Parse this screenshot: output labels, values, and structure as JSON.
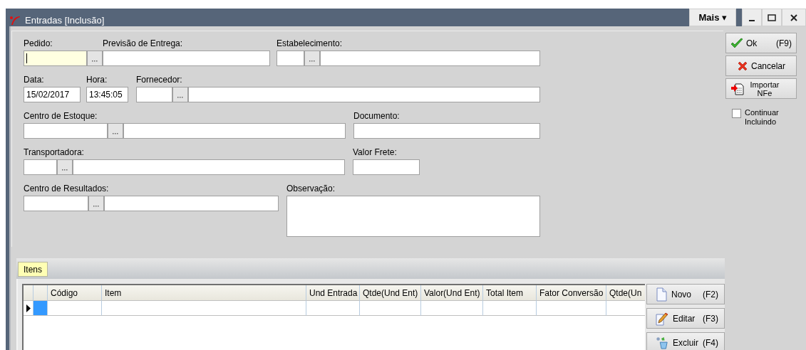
{
  "window": {
    "title": "Entradas [Inclusão]",
    "more_button": "Mais ▾"
  },
  "form": {
    "rows": [
      {
        "fields": [
          {
            "kind": "code",
            "label": "Pedido:",
            "focused": true
          },
          {
            "kind": "text",
            "label": "Previsão de Entrega:"
          },
          {
            "kind": "lookup",
            "label": "Estabelecimento:"
          }
        ]
      },
      {
        "fields": [
          {
            "kind": "text",
            "label": "Data:",
            "value": "15/02/2017"
          },
          {
            "kind": "text",
            "label": "Hora:",
            "value": "13:45:05"
          },
          {
            "kind": "lookup",
            "label": "Fornecedor:"
          }
        ]
      },
      {
        "fields": [
          {
            "kind": "lookup",
            "label": "Centro de Estoque:"
          },
          {
            "kind": "text",
            "label": "Documento:"
          }
        ]
      },
      {
        "fields": [
          {
            "kind": "lookup",
            "label": "Transportadora:"
          },
          {
            "kind": "text",
            "label": "Valor Frete:"
          }
        ]
      },
      {
        "fields": [
          {
            "kind": "lookup",
            "label": "Centro de Resultados:"
          },
          {
            "kind": "memo",
            "label": "Observação:"
          }
        ]
      }
    ]
  },
  "actions": [
    {
      "kind": "ok",
      "label": "Ok",
      "shortcut": "(F9)"
    },
    {
      "kind": "cancel",
      "label": "Cancelar"
    },
    {
      "kind": "import",
      "label": "Importar NFe"
    }
  ],
  "continue_checkbox": {
    "label": "Continuar Incluindo",
    "checked": false
  },
  "tabs": [
    {
      "label": "Itens",
      "selected": true
    }
  ],
  "table": {
    "columns": [
      "Código",
      "Item",
      "Und Entrada",
      "Qtde(Und Ent)",
      "Valor(Und Ent)",
      "Total Item",
      "Fator Conversão",
      "Qtde(Un"
    ],
    "rows": [
      {
        "current": true,
        "selected": true
      }
    ]
  },
  "item_buttons": [
    {
      "kind": "new",
      "label": "Novo",
      "shortcut": "(F2)"
    },
    {
      "kind": "edit",
      "label": "Editar",
      "shortcut": "(F3)"
    },
    {
      "kind": "delete",
      "label": "Excluir",
      "shortcut": "(F4)"
    }
  ]
}
